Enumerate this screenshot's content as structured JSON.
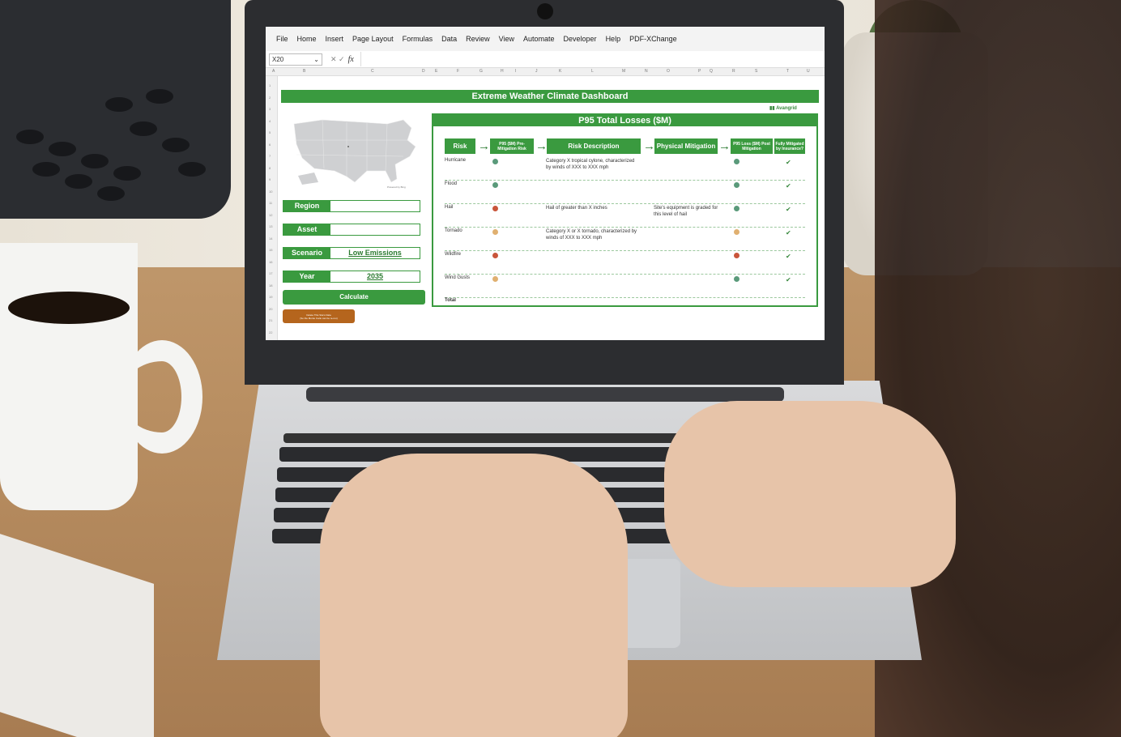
{
  "excel": {
    "menu": [
      "File",
      "Home",
      "Insert",
      "Page Layout",
      "Formulas",
      "Data",
      "Review",
      "View",
      "Automate",
      "Developer",
      "Help",
      "PDF-XChange"
    ],
    "name_box": "X20",
    "fx_label": "fx",
    "columns": [
      "A",
      "B",
      "C",
      "D",
      "E",
      "F",
      "G",
      "H",
      "I",
      "J",
      "K",
      "L",
      "M",
      "N",
      "O",
      "P",
      "Q",
      "R",
      "S",
      "T",
      "U"
    ],
    "rows": [
      "1",
      "2",
      "3",
      "4",
      "5",
      "6",
      "7",
      "8",
      "9",
      "10",
      "11",
      "12",
      "13",
      "14",
      "15",
      "16",
      "17",
      "18",
      "19",
      "20",
      "21",
      "22"
    ]
  },
  "dashboard": {
    "title": "Extreme Weather Climate Dashboard",
    "logo": "Avangrid",
    "map_credit": "Powered by Bing",
    "fields": [
      {
        "label": "Region",
        "value": ""
      },
      {
        "label": "Asset",
        "value": ""
      },
      {
        "label": "Scenario",
        "value": "Low Emissions"
      },
      {
        "label": "Year",
        "value": "2035"
      }
    ],
    "calculate_label": "Calculate",
    "delete_label_1": "Delete This Site's Data",
    "delete_label_2": "(So the Monte Carlo can be re-run)",
    "panel_title": "P95 Total Losses ($M)",
    "headers": {
      "risk": "Risk",
      "pre": "P95 ($M) Pre-Mitigation Risk",
      "desc": "Risk Description",
      "mit": "Physical Mitigation",
      "post": "P95 Loss ($M) Post Mitigation",
      "ins": "Fully Mitigated by Insurance?"
    },
    "risks": [
      {
        "name": "Hurricane",
        "pre": "#5a9a7a",
        "desc": "Category X tropical cylone, characterized by winds of XXX to XXX mph",
        "mit": "",
        "post": "#5a9a7a",
        "insured": "✔"
      },
      {
        "name": "Flood",
        "pre": "#5a9a7a",
        "desc": "",
        "mit": "",
        "post": "#5a9a7a",
        "insured": "✔"
      },
      {
        "name": "Hail",
        "pre": "#c9553a",
        "desc": "Hail of greater than X inches",
        "mit": "Site's equipment is graded for this level of hail",
        "post": "#5a9a7a",
        "insured": "✔"
      },
      {
        "name": "Tornado",
        "pre": "#e0b070",
        "desc": "Category X or X tornado, characterized by winds of XXX to XXX mph",
        "mit": "",
        "post": "#e0b070",
        "insured": "✔"
      },
      {
        "name": "Wildfire",
        "pre": "#c9553a",
        "desc": "",
        "mit": "",
        "post": "#c9553a",
        "insured": "✔"
      },
      {
        "name": "Wind Gusts",
        "pre": "#e0b070",
        "desc": "",
        "mit": "",
        "post": "#5a9a7a",
        "insured": "✔"
      }
    ],
    "total_label": "Total"
  }
}
